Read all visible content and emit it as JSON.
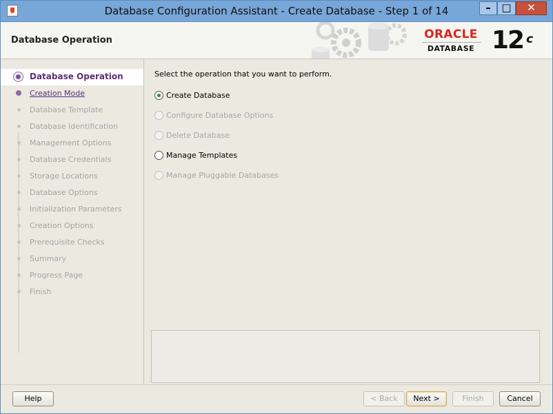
{
  "window": {
    "title": "Database Configuration Assistant - Create Database - Step 1 of 14",
    "controls": {
      "minimize": "–",
      "maximize": "□",
      "close": "✕"
    }
  },
  "header": {
    "title": "Database Operation",
    "logo": {
      "brand": "ORACLE",
      "product": "DATABASE",
      "version": "12",
      "version_suffix": "c"
    }
  },
  "sidebar": {
    "steps": [
      {
        "label": "Database Operation",
        "state": "active"
      },
      {
        "label": "Creation Mode",
        "state": "next"
      },
      {
        "label": "Database Template",
        "state": "disabled"
      },
      {
        "label": "Database Identification",
        "state": "disabled"
      },
      {
        "label": "Management Options",
        "state": "disabled"
      },
      {
        "label": "Database Credentials",
        "state": "disabled"
      },
      {
        "label": "Storage Locations",
        "state": "disabled"
      },
      {
        "label": "Database Options",
        "state": "disabled"
      },
      {
        "label": "Initialization Parameters",
        "state": "disabled"
      },
      {
        "label": "Creation Options",
        "state": "disabled"
      },
      {
        "label": "Prerequisite Checks",
        "state": "disabled"
      },
      {
        "label": "Summary",
        "state": "disabled"
      },
      {
        "label": "Progress Page",
        "state": "disabled"
      },
      {
        "label": "Finish",
        "state": "disabled"
      }
    ]
  },
  "content": {
    "prompt": "Select the operation that you want to perform.",
    "options": [
      {
        "label": "Create Database",
        "selected": true,
        "enabled": true
      },
      {
        "label": "Configure Database Options",
        "selected": false,
        "enabled": false
      },
      {
        "label": "Delete Database",
        "selected": false,
        "enabled": false
      },
      {
        "label": "Manage Templates",
        "selected": false,
        "enabled": true
      },
      {
        "label": "Manage Pluggable Databases",
        "selected": false,
        "enabled": false
      }
    ]
  },
  "footer": {
    "help": "Help",
    "back": "< Back",
    "next": "Next >",
    "finish": "Finish",
    "cancel": "Cancel"
  },
  "colors": {
    "accent_purple": "#5d2e75",
    "oracle_red": "#d9261c",
    "titlebar": "#77a6d8",
    "close_button": "#c7523b"
  }
}
